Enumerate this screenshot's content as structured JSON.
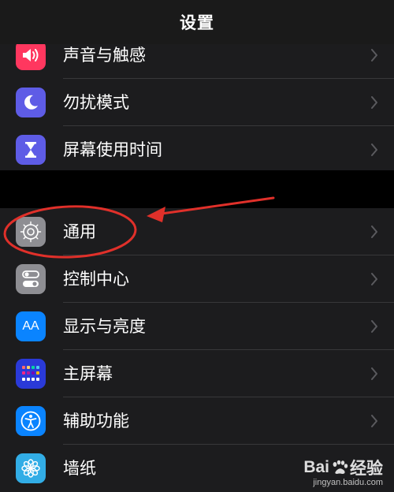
{
  "nav": {
    "title": "设置"
  },
  "group_a": [
    {
      "label": "声音与触感",
      "icon": "speaker-icon",
      "color": "#ff375f"
    },
    {
      "label": "勿扰模式",
      "icon": "moon-icon",
      "color": "#5e5ce6"
    },
    {
      "label": "屏幕使用时间",
      "icon": "hourglass-icon",
      "color": "#5e5ce6"
    }
  ],
  "group_b": [
    {
      "label": "通用",
      "icon": "gear-icon",
      "color": "#8e8e93"
    },
    {
      "label": "控制中心",
      "icon": "toggles-icon",
      "color": "#8e8e93"
    },
    {
      "label": "显示与亮度",
      "icon": "aa-icon",
      "color": "#0a84ff",
      "icon_text": "AA"
    },
    {
      "label": "主屏幕",
      "icon": "home-grid-icon",
      "color": "#2a3ad8"
    },
    {
      "label": "辅助功能",
      "icon": "accessibility-icon",
      "color": "#0a84ff"
    },
    {
      "label": "墙纸",
      "icon": "flower-icon",
      "color": "#32ade6"
    }
  ],
  "annotation": {
    "color": "#e0302a"
  },
  "watermark": {
    "main": "Bai",
    "main_suffix": "经验",
    "sub": "jingyan.baidu.com"
  }
}
